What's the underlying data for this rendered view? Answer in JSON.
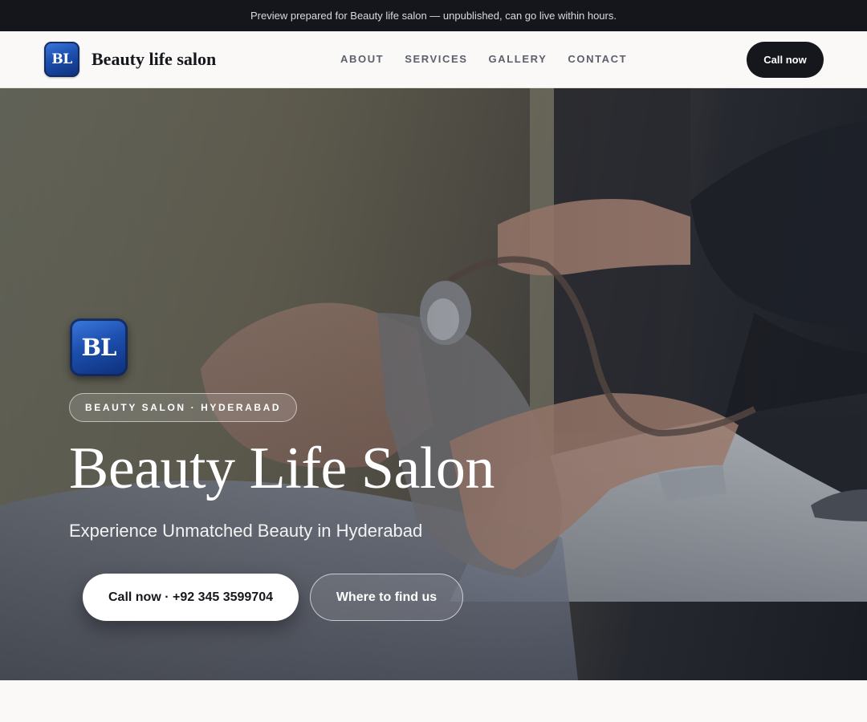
{
  "preview_banner": {
    "text": "Preview prepared for Beauty life salon — unpublished, can go live within hours."
  },
  "header": {
    "logo_text": "BL",
    "brand_name": "Beauty life salon",
    "nav": [
      "ABOUT",
      "SERVICES",
      "GALLERY",
      "CONTACT"
    ],
    "call_button": "Call now"
  },
  "hero": {
    "logo_text": "BL",
    "badge": "BEAUTY SALON · HYDERABAD",
    "title": "Beauty Life Salon",
    "subtitle": "Experience Unmatched Beauty in Hyderabad",
    "primary_button": "Call now · +92 345 3599704",
    "secondary_button": "Where to find us"
  },
  "colors": {
    "banner_bg": "#14161c",
    "accent_dark": "#15171c",
    "logo_blue": "#1c4fae",
    "page_bg": "#faf9f7"
  }
}
